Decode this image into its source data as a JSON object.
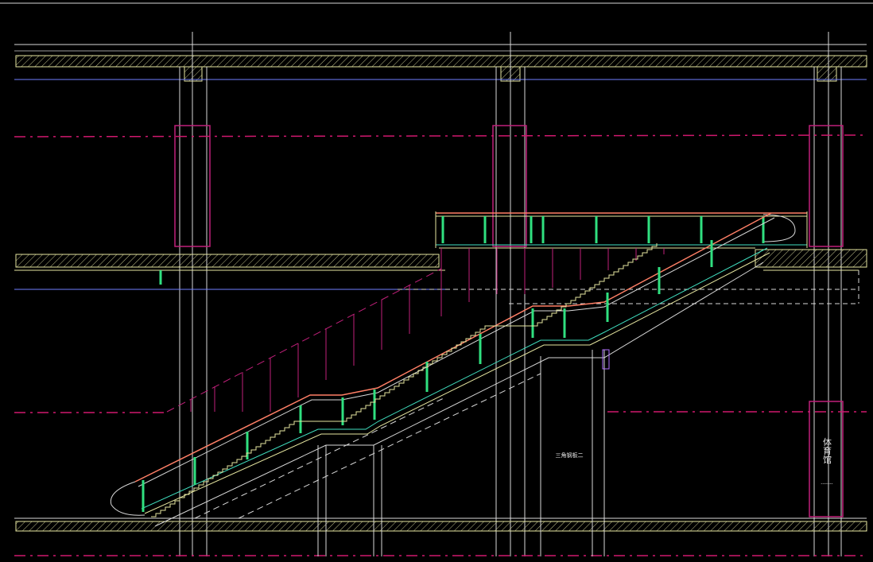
{
  "drawing": {
    "colors": {
      "background": "#000000",
      "outline_white": "#d9d9d9",
      "outline_yellow": "#e6e6a0",
      "magenta": "#d0186e",
      "pink": "#c0207a",
      "salmon": "#ff7f66",
      "cyan_green": "#40e0c0",
      "green": "#30e080",
      "violet": "#b070ff",
      "blue_line": "#7080ff"
    },
    "labels": {
      "center_note": "三角钢板二",
      "wall_sign": "体育馆",
      "wall_sign_sub": "-------"
    }
  }
}
